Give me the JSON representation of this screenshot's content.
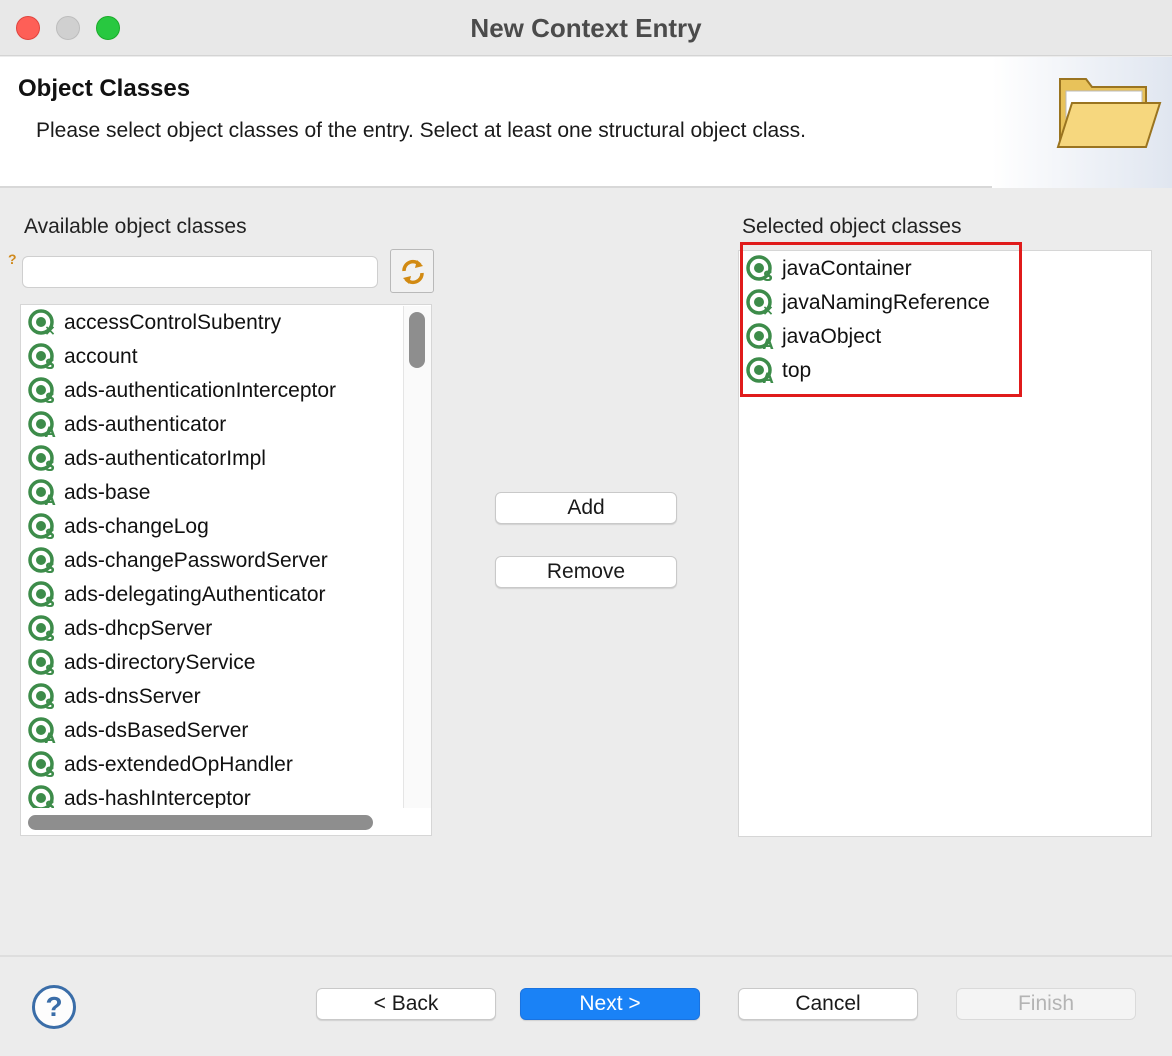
{
  "window": {
    "title": "New Context Entry"
  },
  "header": {
    "title": "Object Classes",
    "description": "Please select object classes of the entry. Select at least one structural object class."
  },
  "available": {
    "label": "Available object classes",
    "filter_value": "",
    "items": [
      {
        "label": "accessControlSubentry",
        "kind": "x"
      },
      {
        "label": "account",
        "kind": "s"
      },
      {
        "label": "ads-authenticationInterceptor",
        "kind": "s"
      },
      {
        "label": "ads-authenticator",
        "kind": "a"
      },
      {
        "label": "ads-authenticatorImpl",
        "kind": "s"
      },
      {
        "label": "ads-base",
        "kind": "a"
      },
      {
        "label": "ads-changeLog",
        "kind": "s"
      },
      {
        "label": "ads-changePasswordServer",
        "kind": "s"
      },
      {
        "label": "ads-delegatingAuthenticator",
        "kind": "s"
      },
      {
        "label": "ads-dhcpServer",
        "kind": "s"
      },
      {
        "label": "ads-directoryService",
        "kind": "s"
      },
      {
        "label": "ads-dnsServer",
        "kind": "s"
      },
      {
        "label": "ads-dsBasedServer",
        "kind": "a"
      },
      {
        "label": "ads-extendedOpHandler",
        "kind": "s"
      },
      {
        "label": "ads-hashInterceptor",
        "kind": "s"
      }
    ]
  },
  "selected": {
    "label": "Selected object classes",
    "items": [
      {
        "label": "javaContainer",
        "kind": "s"
      },
      {
        "label": "javaNamingReference",
        "kind": "x"
      },
      {
        "label": "javaObject",
        "kind": "a"
      },
      {
        "label": "top",
        "kind": "a"
      }
    ]
  },
  "actions": {
    "add": "Add",
    "remove": "Remove"
  },
  "footer": {
    "help": "?",
    "back": "< Back",
    "next": "Next >",
    "cancel": "Cancel",
    "finish": "Finish"
  },
  "icons": {
    "object_class_icon": "object-class-icon",
    "refresh_icon": "refresh-icon",
    "folder_icon": "open-folder-icon",
    "help_icon": "help-icon"
  },
  "colors": {
    "accent": "#1a82f6",
    "highlight": "#e01b1b",
    "icon_green": "#3d8c4a"
  }
}
